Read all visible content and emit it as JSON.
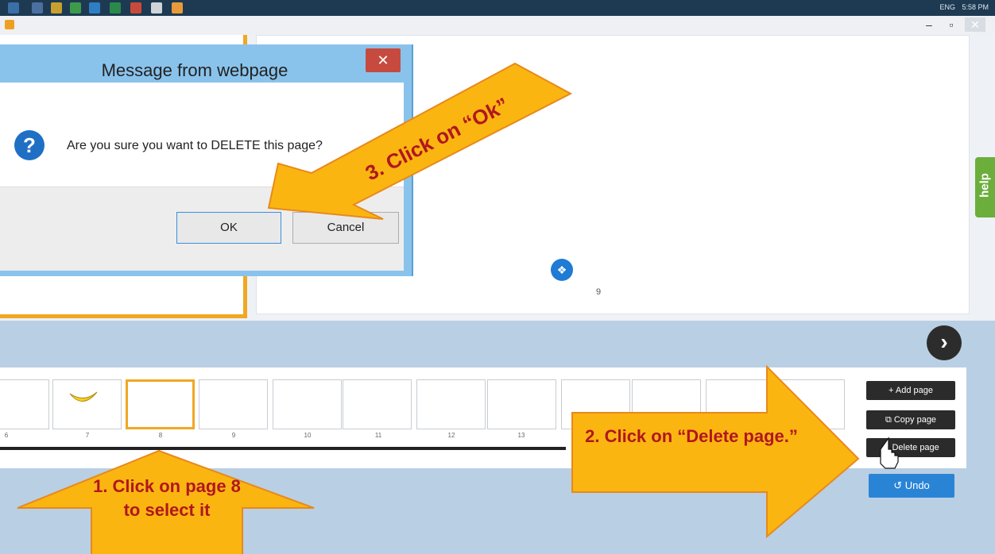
{
  "taskbar": {
    "tray_lang": "ENG",
    "tray_time": "5:58 PM"
  },
  "window": {
    "min": "–",
    "max": "▫",
    "close": "✕"
  },
  "dialog": {
    "title": "Message from webpage",
    "close": "✕",
    "message": "Are you sure you want to DELETE this page?",
    "ok": "OK",
    "cancel": "Cancel"
  },
  "canvas": {
    "page_number": "9"
  },
  "help_label": "help",
  "thumbnails": {
    "labels": [
      "6",
      "7",
      "8",
      "9",
      "10",
      "11",
      "12",
      "13"
    ]
  },
  "actions": {
    "add": "+ Add page",
    "copy": "⧉ Copy page",
    "delete": "✖ Delete page",
    "undo": "↺ Undo"
  },
  "annotations": {
    "step1": "1. Click on page 8 to select it",
    "step2": "2. Click on “Delete page.”",
    "step3": "3. Click on “Ok”"
  },
  "colors": {
    "arrow_fill": "#fbb511",
    "annotation_text": "#b0171f",
    "selected_border": "#f1a722",
    "help_tab": "#6cae3c",
    "undo": "#2a84d6"
  }
}
